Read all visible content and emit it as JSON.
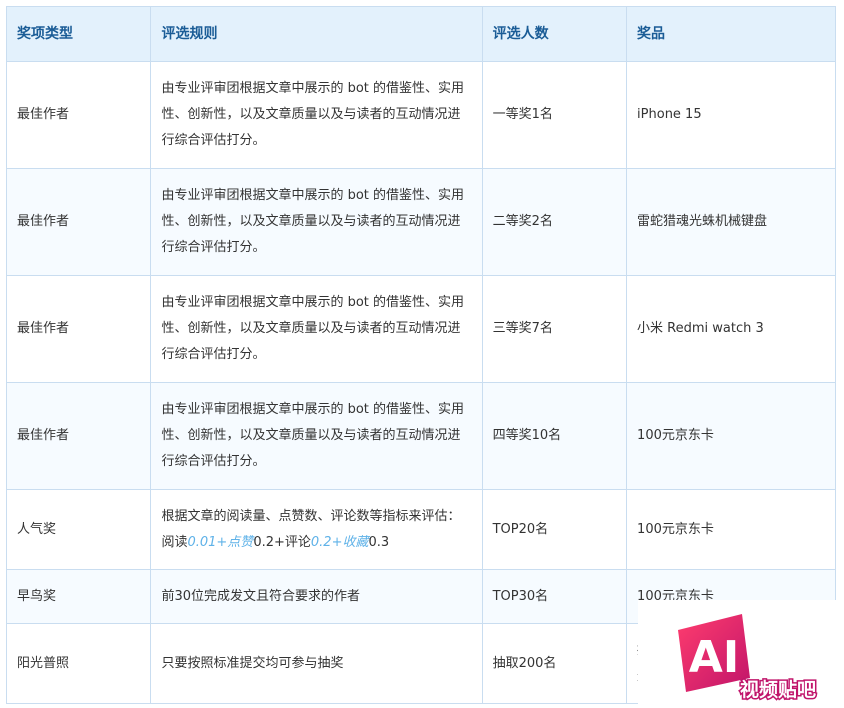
{
  "headers": {
    "award_type": "奖项类型",
    "rules": "评选规则",
    "count": "评选人数",
    "prize": "奖品"
  },
  "rows": [
    {
      "award_type": "最佳作者",
      "rules": "由专业评审团根据文章中展示的 bot 的借鉴性、实用性、创新性，以及文章质量以及与读者的互动情况进行综合评估打分。",
      "count": "一等奖1名",
      "prize": "iPhone 15"
    },
    {
      "award_type": "最佳作者",
      "rules": "由专业评审团根据文章中展示的 bot 的借鉴性、实用性、创新性，以及文章质量以及与读者的互动情况进行综合评估打分。",
      "count": "二等奖2名",
      "prize": "雷蛇猎魂光蛛机械键盘"
    },
    {
      "award_type": "最佳作者",
      "rules": "由专业评审团根据文章中展示的 bot 的借鉴性、实用性、创新性，以及文章质量以及与读者的互动情况进行综合评估打分。",
      "count": "三等奖7名",
      "prize": "小米 Redmi watch 3"
    },
    {
      "award_type": "最佳作者",
      "rules": "由专业评审团根据文章中展示的 bot 的借鉴性、实用性、创新性，以及文章质量以及与读者的互动情况进行综合评估打分。",
      "count": "四等奖10名",
      "prize": "100元京东卡"
    },
    {
      "award_type": "人气奖",
      "rules_parts": {
        "p1": "根据文章的阅读量、点赞数、评论数等指标来评估：阅读",
        "p2": "0.01+点赞",
        "p3": "0.2+评论",
        "p4": "0.2+收藏",
        "p5": "0.3"
      },
      "count": "TOP20名",
      "prize": "100元京东卡"
    },
    {
      "award_type": "早鸟奖",
      "rules": "前30位完成发文且符合要求的作者",
      "count": "TOP30名",
      "prize": "100元京东卡"
    },
    {
      "award_type": "阳光普照",
      "rules": "只要按照标准提交均可参与抽奖",
      "count": "抽取200名",
      "prize": "掘",
      "prize_line2": "光"
    }
  ],
  "watermark": {
    "logo_text": "AI",
    "caption": "视频贴吧",
    "accent_colors": [
      "#ff3d6e",
      "#c0146a"
    ]
  }
}
